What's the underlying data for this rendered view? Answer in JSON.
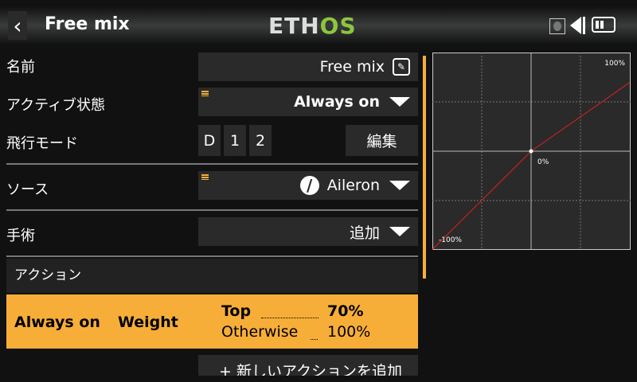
{
  "header": {
    "title": "Free mix",
    "logo": "ETHOS",
    "logo_accent": "#8cc63f"
  },
  "rows": {
    "name": {
      "label": "名前",
      "value": "Free mix"
    },
    "active": {
      "label": "アクティブ状態",
      "value": "Always on"
    },
    "flight_modes": {
      "label": "飛行モード",
      "modes": [
        "D",
        "1",
        "2"
      ],
      "edit": "編集"
    },
    "source": {
      "label": "ソース",
      "value": "Aileron"
    },
    "operation": {
      "label": "手術",
      "value": "追加"
    }
  },
  "actions": {
    "header": "アクション",
    "item": {
      "condition": "Always on",
      "type": "Weight",
      "top_label": "Top",
      "top_value": "70%",
      "otherwise_label": "Otherwise",
      "otherwise_value": "100%"
    },
    "add_button": "+ 新しいアクションを追加"
  },
  "graph": {
    "top_label": "100%",
    "center_label": "0%",
    "bottom_label": "-100%",
    "curve_color": "#e02020",
    "points": [
      [
        -100,
        -100
      ],
      [
        0,
        0
      ],
      [
        100,
        70
      ]
    ]
  },
  "colors": {
    "accent": "#f7ae38"
  }
}
